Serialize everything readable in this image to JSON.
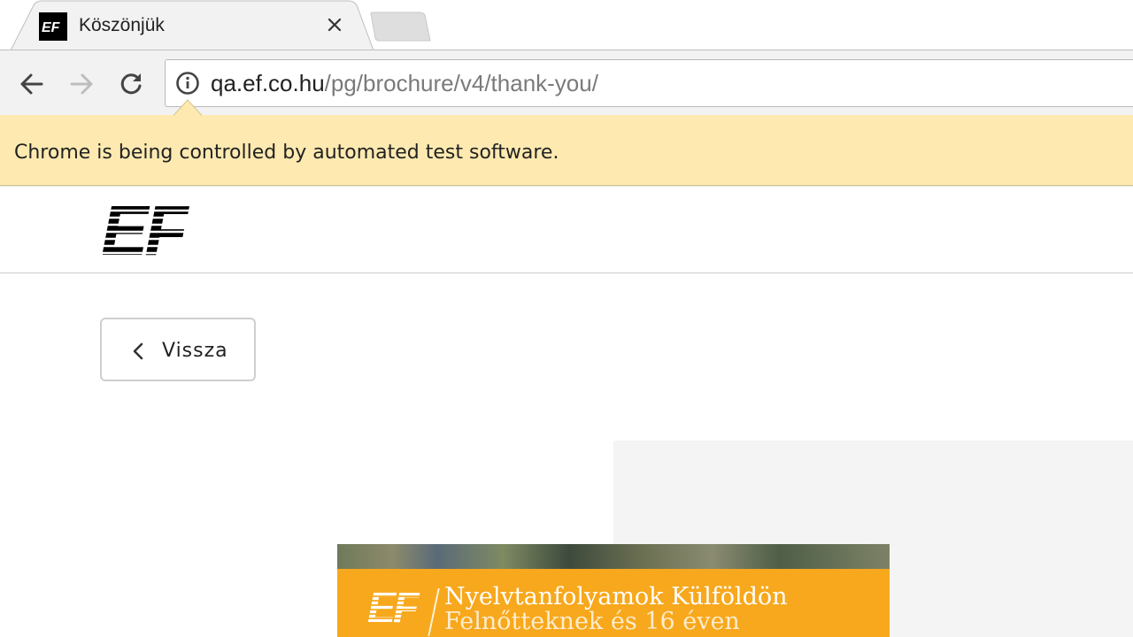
{
  "browser": {
    "tab": {
      "title": "Köszönjük",
      "favicon": "ef-logo-icon"
    },
    "toolbar": {
      "back_icon": "arrow-left-icon",
      "forward_icon": "arrow-right-icon",
      "reload_icon": "reload-icon"
    },
    "omnibox": {
      "info_icon": "info-icon",
      "url_host": "qa.ef.co.hu",
      "url_path": "/pg/brochure/v4/thank-you/"
    },
    "infobar": {
      "message": "Chrome is being controlled by automated test software.",
      "background": "#feeab1"
    }
  },
  "page": {
    "logo": "ef-logo",
    "back_button": {
      "label": "Vissza",
      "icon": "chevron-left-icon"
    },
    "brochure": {
      "logo": "ef-logo",
      "title": "Nyelvtanfolyamok Külföldön",
      "subtitle": "Felnőtteknek és 16 éven",
      "accent": "#f7a81c"
    }
  }
}
